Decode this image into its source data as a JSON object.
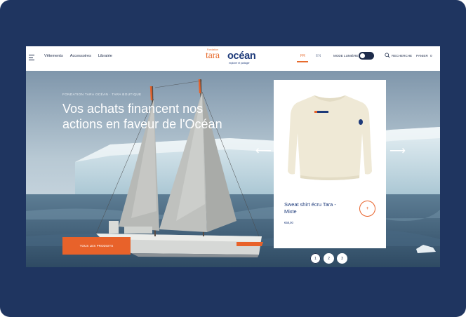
{
  "header": {
    "nav": [
      "Vêtements",
      "Accessoires",
      "Librairie"
    ],
    "logo": {
      "small": "Fondation",
      "tara": "tara",
      "ocean": "océan",
      "tagline": "explorer et partager"
    },
    "languages": {
      "fr": "FR",
      "en": "EN"
    },
    "mode_label": "MODE LUMIÈRE",
    "search_label": "RECHERCHE",
    "basket_label": "PANIER",
    "basket_count": "0"
  },
  "hero": {
    "eyebrow": "FONDATION TARA OCÉAN · TARA BOUTIQUE",
    "headline": "Vos achats financent nos actions en faveur de l'Océan",
    "cta_label": "TOUS LES PRODUITS",
    "arrow_left": "⟵",
    "arrow_right": "⟶"
  },
  "product": {
    "title": "Sweat shirt écru Tara - Mixte",
    "price": "€58,00",
    "add_symbol": "+"
  },
  "pagination": [
    "1",
    "2",
    "3"
  ],
  "colors": {
    "navy": "#1f3560",
    "accent": "#e8622a",
    "brand_blue": "#1d3a7a"
  }
}
